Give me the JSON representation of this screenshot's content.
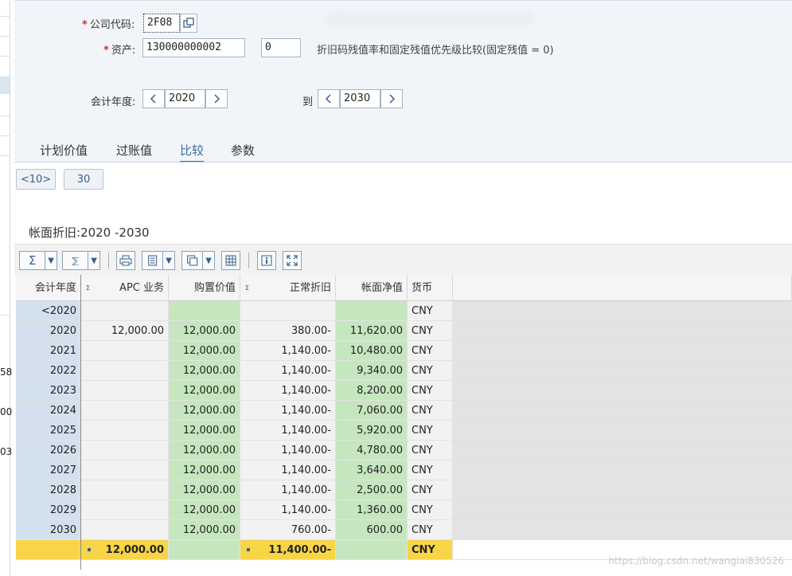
{
  "form": {
    "company_code_label": "公司代码:",
    "company_code_value": "2F08",
    "asset_label": "资产:",
    "asset_value": "130000000002",
    "asset_sub_value": "0",
    "asset_note": "折旧码残值率和固定残值优先级比较(固定残值 = 0)",
    "fiscal_year_label": "会计年度:",
    "fiscal_year_from": "2020",
    "to_label": "到",
    "fiscal_year_to": "2030",
    "prev_symbol": "‹",
    "next_symbol": "›"
  },
  "tabs": [
    {
      "label": "计划价值"
    },
    {
      "label": "过账值"
    },
    {
      "label": "比较",
      "active": true
    },
    {
      "label": "参数"
    }
  ],
  "pager": {
    "btn1": "<10>",
    "btn2": "30"
  },
  "section_title": "帐面折旧:2020 -2030",
  "toolbar_icons": [
    "sigma-icon",
    "subtotal-icon",
    "print-icon",
    "export-icon",
    "layout-icon",
    "calculator-icon",
    "info-icon",
    "fullscreen-icon"
  ],
  "table": {
    "columns": {
      "year": "会计年度",
      "apc": "APC 业务",
      "acquisition": "购置价值",
      "depreciation": "正常折旧",
      "nbv": "帐面净值",
      "currency": "货币"
    },
    "sigma_mark": "Σ",
    "rows": [
      {
        "year": "<2020",
        "apc": "",
        "acquisition": "",
        "depreciation": "",
        "nbv": "",
        "currency": "CNY"
      },
      {
        "year": "2020",
        "apc": "12,000.00",
        "acquisition": "12,000.00",
        "depreciation": "380.00-",
        "nbv": "11,620.00",
        "currency": "CNY"
      },
      {
        "year": "2021",
        "apc": "",
        "acquisition": "12,000.00",
        "depreciation": "1,140.00-",
        "nbv": "10,480.00",
        "currency": "CNY"
      },
      {
        "year": "2022",
        "apc": "",
        "acquisition": "12,000.00",
        "depreciation": "1,140.00-",
        "nbv": "9,340.00",
        "currency": "CNY"
      },
      {
        "year": "2023",
        "apc": "",
        "acquisition": "12,000.00",
        "depreciation": "1,140.00-",
        "nbv": "8,200.00",
        "currency": "CNY"
      },
      {
        "year": "2024",
        "apc": "",
        "acquisition": "12,000.00",
        "depreciation": "1,140.00-",
        "nbv": "7,060.00",
        "currency": "CNY"
      },
      {
        "year": "2025",
        "apc": "",
        "acquisition": "12,000.00",
        "depreciation": "1,140.00-",
        "nbv": "5,920.00",
        "currency": "CNY"
      },
      {
        "year": "2026",
        "apc": "",
        "acquisition": "12,000.00",
        "depreciation": "1,140.00-",
        "nbv": "4,780.00",
        "currency": "CNY"
      },
      {
        "year": "2027",
        "apc": "",
        "acquisition": "12,000.00",
        "depreciation": "1,140.00-",
        "nbv": "3,640.00",
        "currency": "CNY"
      },
      {
        "year": "2028",
        "apc": "",
        "acquisition": "12,000.00",
        "depreciation": "1,140.00-",
        "nbv": "2,500.00",
        "currency": "CNY"
      },
      {
        "year": "2029",
        "apc": "",
        "acquisition": "12,000.00",
        "depreciation": "1,140.00-",
        "nbv": "1,360.00",
        "currency": "CNY"
      },
      {
        "year": "2030",
        "apc": "",
        "acquisition": "12,000.00",
        "depreciation": "760.00-",
        "nbv": "600.00",
        "currency": "CNY"
      }
    ],
    "total": {
      "apc": "12,000.00",
      "depreciation": "11,400.00-",
      "currency": "CNY"
    }
  },
  "left_fragments": [
    "58",
    "00",
    "03"
  ],
  "watermark": "https://blog.csdn.net/wanglai830526"
}
